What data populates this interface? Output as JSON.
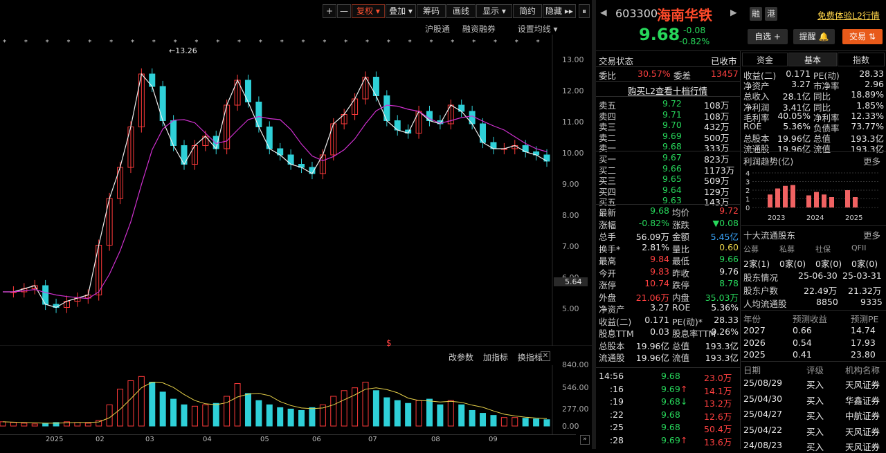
{
  "toolbar": {
    "plus": "+",
    "minus": "—",
    "fuquan": "复权",
    "diejia": "叠加",
    "chouma": "筹码",
    "huaxian": "画线",
    "xianshi": "显示",
    "jianyue": "简约",
    "yincang": "隐藏"
  },
  "sublinks": {
    "hgt": "沪股通",
    "rzrq": "融资融券",
    "sz": "设置均线"
  },
  "price_axis": [
    "13.00",
    "12.00",
    "11.00",
    "10.00",
    "9.00",
    "8.00",
    "7.00",
    "6.00",
    "5.00"
  ],
  "current_axis_label": "5.64",
  "high_marker": "13.26",
  "indicator_links": {
    "params": "改参数",
    "add": "加指标",
    "switch": "换指标"
  },
  "volume_axis": [
    "840.00",
    "546.00",
    "277.00",
    "0.00"
  ],
  "months": [
    "2025",
    "02",
    "03",
    "04",
    "05",
    "06",
    "07",
    "08",
    "09"
  ],
  "chart_data": [
    {
      "type": "line",
      "title": "",
      "series": [
        {
          "name": "",
          "values": [
            5.5,
            5.5,
            5.6,
            5.7,
            5.1,
            5.0,
            5.2,
            5.3,
            5.4,
            7.0,
            8.5,
            9.5,
            10.8,
            12.5,
            12.1,
            11.0,
            10.2,
            9.6,
            10.2,
            10.5,
            10.1,
            11.5,
            12.3,
            11.6,
            10.8,
            10.1,
            9.9,
            9.6,
            9.5,
            9.3,
            9.9,
            10.9,
            11.2,
            11.7,
            12.4,
            11.8,
            11.0,
            10.7,
            10.6,
            11.3,
            11.0,
            10.9,
            11.5,
            11.3,
            10.9,
            10.3,
            10.1,
            10.1,
            10.2,
            10.0,
            9.9,
            9.7
          ]
        }
      ],
      "ylim": [
        4.5,
        13.5
      ]
    },
    {
      "type": "bar",
      "title": "",
      "values": [
        60,
        50,
        40,
        30,
        40,
        50,
        60,
        50,
        40,
        80,
        300,
        520,
        640,
        700,
        620,
        480,
        380,
        300,
        280,
        300,
        320,
        420,
        600,
        460,
        360,
        300,
        260,
        240,
        220,
        260,
        300,
        420,
        500,
        540,
        620,
        500,
        400,
        360,
        320,
        360,
        380,
        300,
        360,
        300,
        220,
        180,
        150,
        120,
        120,
        110,
        100,
        90
      ],
      "ylim": [
        0,
        840
      ]
    }
  ],
  "stock": {
    "code": "603300",
    "name": "海南华铁",
    "tag1": "融",
    "tag2": "港",
    "l2": "免费体验L2行情",
    "price": "9.68",
    "change": "-0.08",
    "change_pct": "-0.82%",
    "btn_zixuan": "自选 +",
    "btn_tixing": "提醒",
    "btn_jiaoyi": "交易"
  },
  "orderbook": {
    "status_label": "交易状态",
    "status_value": "已收市",
    "weibi_label": "委比",
    "weibi": "30.57%",
    "weicha_label": "委差",
    "weicha": "13457",
    "buy_l2": "购买L2查看十档行情",
    "asks": [
      {
        "label": "卖五",
        "price": "9.72",
        "vol": "108万"
      },
      {
        "label": "卖四",
        "price": "9.71",
        "vol": "108万"
      },
      {
        "label": "卖三",
        "price": "9.70",
        "vol": "432万"
      },
      {
        "label": "卖二",
        "price": "9.69",
        "vol": "500万"
      },
      {
        "label": "卖一",
        "price": "9.68",
        "vol": "333万"
      }
    ],
    "bids": [
      {
        "label": "买一",
        "price": "9.67",
        "vol": "823万"
      },
      {
        "label": "买二",
        "price": "9.66",
        "vol": "1173万"
      },
      {
        "label": "买三",
        "price": "9.65",
        "vol": "509万"
      },
      {
        "label": "买四",
        "price": "9.64",
        "vol": "129万"
      },
      {
        "label": "买五",
        "price": "9.63",
        "vol": "143万"
      }
    ]
  },
  "quote": [
    {
      "l1": "最新",
      "v1": "9.68",
      "c1": "grn",
      "l2": "均价",
      "v2": "9.72",
      "c2": "red"
    },
    {
      "l1": "涨幅",
      "v1": "-0.82%",
      "c1": "grn",
      "l2": "涨跌",
      "v2": "▼0.08",
      "c2": "grn"
    },
    {
      "l1": "总手",
      "v1": "56.09万",
      "c1": "wht",
      "l2": "金额",
      "v2": "5.45亿",
      "c2": "blu"
    },
    {
      "l1": "换手*",
      "v1": "2.81%",
      "c1": "wht",
      "l2": "量比",
      "v2": "0.60",
      "c2": "yel"
    },
    {
      "l1": "最高",
      "v1": "9.84",
      "c1": "red",
      "l2": "最低",
      "v2": "9.66",
      "c2": "grn"
    },
    {
      "l1": "今开",
      "v1": "9.83",
      "c1": "red",
      "l2": "昨收",
      "v2": "9.76",
      "c2": "wht"
    },
    {
      "l1": "涨停",
      "v1": "10.74",
      "c1": "red",
      "l2": "跌停",
      "v2": "8.78",
      "c2": "grn"
    },
    {
      "l1": "外盘",
      "v1": "21.06万",
      "c1": "red",
      "l2": "内盘",
      "v2": "35.03万",
      "c2": "grn"
    },
    {
      "l1": "净资产",
      "v1": "3.27",
      "c1": "wht",
      "l2": "ROE",
      "v2": "5.36%",
      "c2": "wht"
    },
    {
      "l1": "收益(二)",
      "v1": "0.171",
      "c1": "wht",
      "l2": "PE(动)*",
      "v2": "28.33",
      "c2": "wht"
    },
    {
      "l1": "股息TTM",
      "v1": "0.03",
      "c1": "wht",
      "l2": "股息率TTM",
      "v2": "0.26%",
      "c2": "wht"
    },
    {
      "l1": "总股本",
      "v1": "19.96亿",
      "c1": "wht",
      "l2": "总值",
      "v2": "193.3亿",
      "c2": "wht"
    },
    {
      "l1": "流通股",
      "v1": "19.96亿",
      "c1": "wht",
      "l2": "流值",
      "v2": "193.3亿",
      "c2": "wht"
    }
  ],
  "ticks": [
    {
      "t": "14:56",
      "p": "9.68",
      "a": "",
      "v": "23.0万"
    },
    {
      "t": ":16",
      "p": "9.69",
      "a": "↑",
      "v": "14.1万"
    },
    {
      "t": ":19",
      "p": "9.68",
      "a": "↓",
      "v": "13.2万"
    },
    {
      "t": ":22",
      "p": "9.68",
      "a": "",
      "v": "12.6万"
    },
    {
      "t": ":25",
      "p": "9.68",
      "a": "",
      "v": "50.4万"
    },
    {
      "t": ":28",
      "p": "9.69",
      "a": "↑",
      "v": "13.6万"
    }
  ],
  "tabs": {
    "zijin": "资金",
    "jiben": "基本",
    "zhishu": "指数"
  },
  "fundamentals": [
    {
      "l1": "收益(二)",
      "v1": "0.171",
      "l2": "PE(动)",
      "v2": "28.33"
    },
    {
      "l1": "净资产",
      "v1": "3.27",
      "l2": "市净率",
      "v2": "2.96"
    },
    {
      "l1": "总收入",
      "v1": "28.1亿",
      "l2": "同比",
      "v2": "18.89%"
    },
    {
      "l1": "净利润",
      "v1": "3.41亿",
      "l2": "同比",
      "v2": "1.85%"
    },
    {
      "l1": "毛利率",
      "v1": "40.05%",
      "l2": "净利率",
      "v2": "12.33%"
    },
    {
      "l1": "ROE",
      "v1": "5.36%",
      "l2": "负债率",
      "v2": "73.77%"
    },
    {
      "l1": "总股本",
      "v1": "19.96亿",
      "l2": "总值",
      "v2": "193.3亿"
    },
    {
      "l1": "流通股",
      "v1": "19.96亿",
      "l2": "流值",
      "v2": "193.3亿"
    }
  ],
  "profit": {
    "title": "利润趋势(亿)",
    "more": "更多",
    "yticks": [
      "4",
      "3",
      "2",
      "1",
      "0"
    ],
    "years": [
      "2023",
      "2024",
      "2025"
    ],
    "values": [
      1.5,
      2.2,
      2.5,
      2.6,
      1.4,
      1.8,
      1.5,
      1.2,
      2.0,
      1.2
    ]
  },
  "holders": {
    "title": "十大流通股东",
    "more": "更多",
    "heads": [
      "公募",
      "私募",
      "社保",
      "QFII"
    ],
    "vals": [
      "2家(1)",
      "0家(0)",
      "0家(0)",
      "0家(0)"
    ],
    "info_label": "股东情况",
    "date1": "25-06-30",
    "date2": "25-03-31",
    "count_label": "股东户数",
    "count1": "22.49万",
    "count2": "21.32万",
    "avg_label": "人均流通股",
    "avg1": "8850",
    "avg2": "9335"
  },
  "forecast": {
    "heads": [
      "年份",
      "预测收益",
      "预测PE"
    ],
    "rows": [
      [
        "2027",
        "0.66",
        "14.74"
      ],
      [
        "2026",
        "0.54",
        "17.93"
      ],
      [
        "2025",
        "0.41",
        "23.80"
      ]
    ]
  },
  "ratings": {
    "heads": [
      "日期",
      "评级",
      "机构名称"
    ],
    "rows": [
      [
        "25/08/29",
        "买入",
        "天风证券"
      ],
      [
        "25/04/30",
        "买入",
        "华鑫证券"
      ],
      [
        "25/04/27",
        "买入",
        "中航证券"
      ],
      [
        "25/04/22",
        "买入",
        "天风证券"
      ],
      [
        "24/08/23",
        "买入",
        "天风证券"
      ]
    ]
  }
}
